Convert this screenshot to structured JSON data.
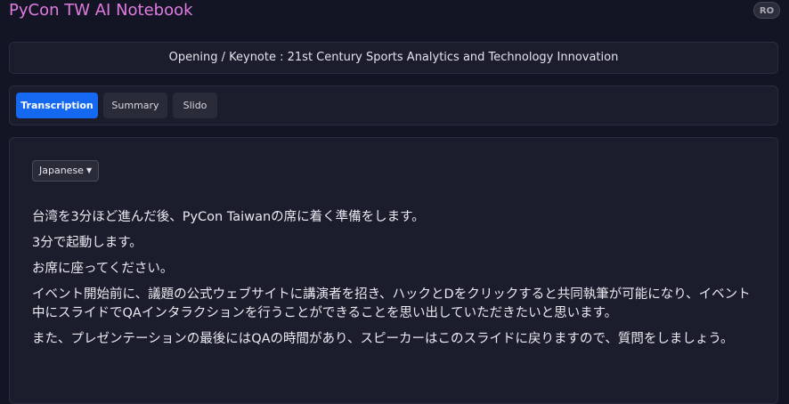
{
  "app": {
    "title": "PyCon TW AI Notebook",
    "avatar_initials": "RO"
  },
  "session": {
    "title": "Opening / Keynote : 21st Century Sports Analytics and Technology Innovation"
  },
  "tabs": [
    {
      "label": "Transcription",
      "active": true
    },
    {
      "label": "Summary",
      "active": false
    },
    {
      "label": "Slido",
      "active": false
    }
  ],
  "language_select": {
    "selected": "Japanese"
  },
  "transcript": {
    "lines": [
      "台湾を3分ほど進んだ後、PyCon Taiwanの席に着く準備をします。",
      "3分で起動します。",
      "お席に座ってください。",
      "イベント開始前に、議題の公式ウェブサイトに講演者を招き、ハックとDをクリックすると共同執筆が可能になり、イベント中にスライドでQAインタラクションを行うことができることを思い出していただきたいと思います。",
      "また、プレゼンテーションの最後にはQAの時間があり、スピーカーはこのスライドに戻りますので、質問をしましょう。"
    ]
  },
  "colors": {
    "accent": "#1569f0",
    "title": "#e07be0",
    "background": "#141524"
  }
}
